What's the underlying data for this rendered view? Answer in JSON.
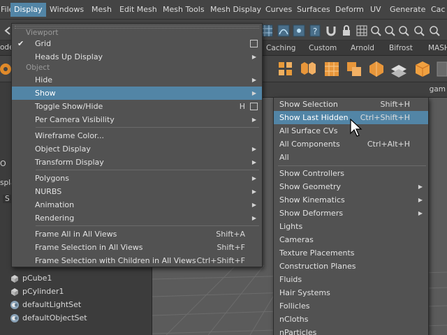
{
  "menubar": {
    "items": [
      "File",
      "Display",
      "Windows",
      "Mesh",
      "Edit Mesh",
      "Mesh Tools",
      "Mesh Display",
      "Curves",
      "Surfaces",
      "Deform",
      "UV",
      "Generate",
      "Cac"
    ],
    "active": "Display"
  },
  "shelf": {
    "tabs": [
      "Caching",
      "Custom",
      "Arnold",
      "Bifrost",
      "MASH"
    ]
  },
  "edge_fragments": {
    "mode": "ode",
    "search": "O",
    "displa": "spla",
    "s_tab": "S",
    "viewport_cam": "gam"
  },
  "outliner": {
    "items": [
      {
        "label": "pCube1",
        "icon": "mesh-icon"
      },
      {
        "label": "pCylinder1",
        "icon": "mesh-icon"
      },
      {
        "label": "defaultLightSet",
        "icon": "set-icon"
      },
      {
        "label": "defaultObjectSet",
        "icon": "set-icon"
      }
    ]
  },
  "display_menu": {
    "sections": {
      "viewport": "Viewport",
      "object": "Object"
    },
    "items": {
      "grid": "Grid",
      "heads_up": "Heads Up Display",
      "hide": "Hide",
      "show": "Show",
      "toggle": "Toggle Show/Hide",
      "toggle_shortcut": "H",
      "per_camera": "Per Camera Visibility",
      "wireframe_color": "Wireframe Color...",
      "object_display": "Object Display",
      "transform_display": "Transform Display",
      "polygons": "Polygons",
      "nurbs": "NURBS",
      "animation": "Animation",
      "rendering": "Rendering",
      "frame_all": "Frame All in All Views",
      "frame_all_shortcut": "Shift+A",
      "frame_sel": "Frame Selection in All Views",
      "frame_sel_shortcut": "Shift+F",
      "frame_sel_children": "Frame Selection with Children in All Views",
      "frame_sel_children_shortcut": "Ctrl+Shift+F"
    },
    "highlighted": "Show",
    "checked": "Grid"
  },
  "show_menu": {
    "items": {
      "show_selection": "Show Selection",
      "show_selection_shortcut": "Shift+H",
      "show_last_hidden": "Show Last Hidden",
      "show_last_hidden_shortcut": "Ctrl+Shift+H",
      "all_surface_cvs": "All Surface CVs",
      "all_components": "All Components",
      "all_components_shortcut": "Ctrl+Alt+H",
      "all": "All",
      "show_controllers": "Show Controllers",
      "show_geometry": "Show Geometry",
      "show_kinematics": "Show Kinematics",
      "show_deformers": "Show Deformers",
      "lights": "Lights",
      "cameras": "Cameras",
      "texture_placements": "Texture Placements",
      "construction_planes": "Construction Planes",
      "fluids": "Fluids",
      "hair_systems": "Hair Systems",
      "follicles": "Follicles",
      "ncloths": "nCloths",
      "nparticles": "nParticles"
    },
    "highlighted": "Show Last Hidden"
  },
  "colors": {
    "highlight": "#5285a6",
    "menu_bg": "#525252",
    "app_bg": "#444444",
    "viewport_bg": "#5a5a5a"
  }
}
